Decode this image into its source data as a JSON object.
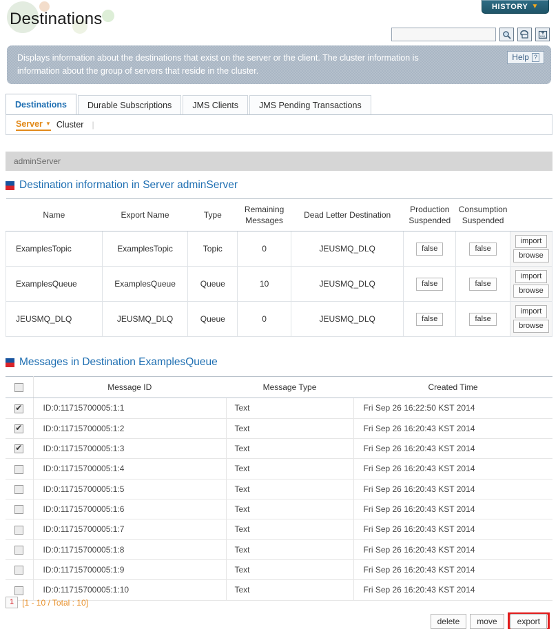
{
  "header": {
    "title": "Destinations",
    "history_button": "HISTORY",
    "history_caret": "chevron-down-icon",
    "search_value": "",
    "search_placeholder": "",
    "icons": [
      "search-icon",
      "print-icon",
      "xml-export-icon"
    ]
  },
  "banner": {
    "text": "Displays information about the destinations that exist on the server or the client. The cluster information is information about the group of servers that reside in the cluster.",
    "help_label": "Help",
    "help_mark": "?"
  },
  "tabs": [
    {
      "label": "Destinations",
      "active": true
    },
    {
      "label": "Durable Subscriptions",
      "active": false
    },
    {
      "label": "JMS Clients",
      "active": false
    },
    {
      "label": "JMS Pending Transactions",
      "active": false
    }
  ],
  "subnav": [
    {
      "label": "Server",
      "active": true
    },
    {
      "label": "Cluster",
      "active": false
    }
  ],
  "server_bar": {
    "name": "adminServer"
  },
  "destinations_section": {
    "title": "Destination information in Server adminServer",
    "columns": [
      "Name",
      "Export Name",
      "Type",
      "Remaining Messages",
      "Dead Letter Destination",
      "Production Suspended",
      "Consumption Suspended",
      ""
    ],
    "column_lines": {
      "remaining": [
        "Remaining",
        "Messages"
      ],
      "production": [
        "Production",
        "Suspended"
      ],
      "consumption": [
        "Consumption",
        "Suspended"
      ]
    },
    "rows": [
      {
        "name": "ExamplesTopic",
        "export_name": "ExamplesTopic",
        "type": "Topic",
        "remaining_messages": "0",
        "dead_letter_destination": "JEUSMQ_DLQ",
        "production_suspended": "false",
        "consumption_suspended": "false",
        "actions": [
          "import",
          "browse"
        ]
      },
      {
        "name": "ExamplesQueue",
        "export_name": "ExamplesQueue",
        "type": "Queue",
        "remaining_messages": "10",
        "dead_letter_destination": "JEUSMQ_DLQ",
        "production_suspended": "false",
        "consumption_suspended": "false",
        "actions": [
          "import",
          "browse"
        ]
      },
      {
        "name": "JEUSMQ_DLQ",
        "export_name": "JEUSMQ_DLQ",
        "type": "Queue",
        "remaining_messages": "0",
        "dead_letter_destination": "JEUSMQ_DLQ",
        "production_suspended": "false",
        "consumption_suspended": "false",
        "actions": [
          "import",
          "browse"
        ]
      }
    ]
  },
  "messages_section": {
    "title": "Messages in Destination ExamplesQueue",
    "columns": [
      "",
      "Message ID",
      "Message Type",
      "Created Time"
    ],
    "select_all_checked": false,
    "rows": [
      {
        "checked": true,
        "message_id": "ID:0:11715700005:1:1",
        "message_type": "Text",
        "created_time": "Fri Sep 26 16:22:50 KST 2014"
      },
      {
        "checked": true,
        "message_id": "ID:0:11715700005:1:2",
        "message_type": "Text",
        "created_time": "Fri Sep 26 16:20:43 KST 2014"
      },
      {
        "checked": true,
        "message_id": "ID:0:11715700005:1:3",
        "message_type": "Text",
        "created_time": "Fri Sep 26 16:20:43 KST 2014"
      },
      {
        "checked": false,
        "message_id": "ID:0:11715700005:1:4",
        "message_type": "Text",
        "created_time": "Fri Sep 26 16:20:43 KST 2014"
      },
      {
        "checked": false,
        "message_id": "ID:0:11715700005:1:5",
        "message_type": "Text",
        "created_time": "Fri Sep 26 16:20:43 KST 2014"
      },
      {
        "checked": false,
        "message_id": "ID:0:11715700005:1:6",
        "message_type": "Text",
        "created_time": "Fri Sep 26 16:20:43 KST 2014"
      },
      {
        "checked": false,
        "message_id": "ID:0:11715700005:1:7",
        "message_type": "Text",
        "created_time": "Fri Sep 26 16:20:43 KST 2014"
      },
      {
        "checked": false,
        "message_id": "ID:0:11715700005:1:8",
        "message_type": "Text",
        "created_time": "Fri Sep 26 16:20:43 KST 2014"
      },
      {
        "checked": false,
        "message_id": "ID:0:11715700005:1:9",
        "message_type": "Text",
        "created_time": "Fri Sep 26 16:20:43 KST 2014"
      },
      {
        "checked": false,
        "message_id": "ID:0:11715700005:1:10",
        "message_type": "Text",
        "created_time": "Fri Sep 26 16:20:43 KST 2014"
      }
    ]
  },
  "pager": {
    "page": "1",
    "info": "[1 - 10 / Total : 10]"
  },
  "footer_buttons": [
    {
      "label": "delete",
      "highlighted": false
    },
    {
      "label": "move",
      "highlighted": false
    },
    {
      "label": "export",
      "highlighted": true
    }
  ],
  "colors": {
    "accent_blue": "#1f6fb2",
    "accent_orange": "#e28a1b",
    "history_teal": "#2e6d85",
    "banner_bg": "#a9b6c4",
    "highlight_red": "#e01b1b",
    "pager_red": "#d8232a"
  }
}
